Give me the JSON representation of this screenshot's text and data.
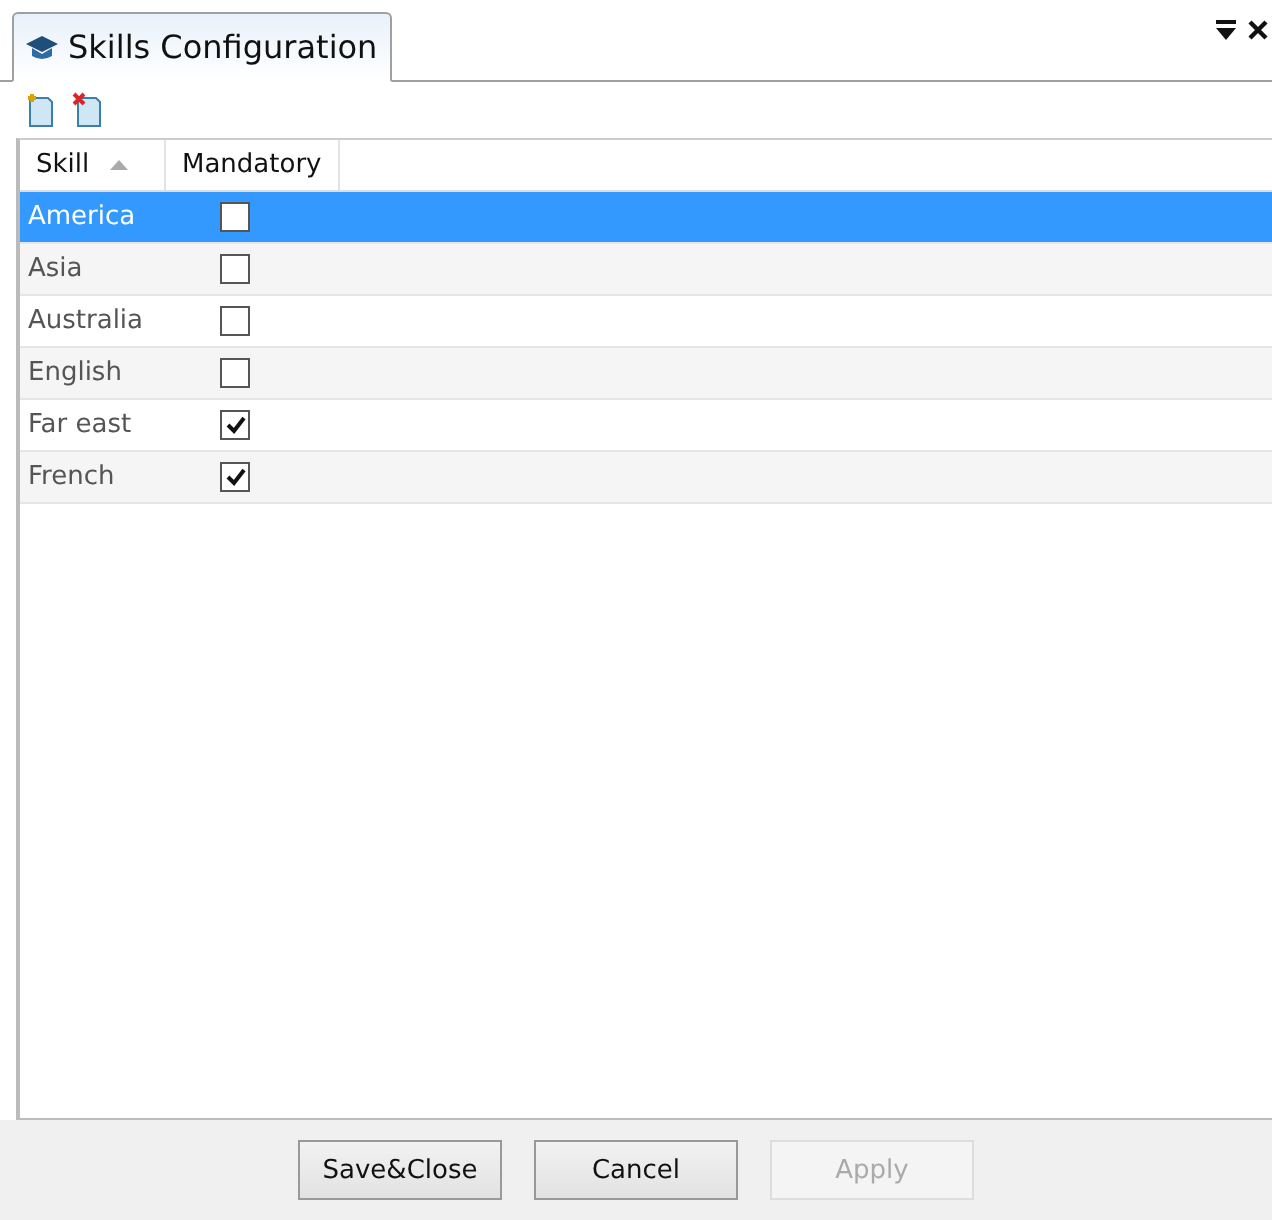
{
  "tab": {
    "title": "Skills Configuration",
    "selected": true
  },
  "table": {
    "columns": [
      {
        "label": "Skill",
        "sorted": true
      },
      {
        "label": "Mandatory",
        "sorted": false
      }
    ],
    "rows": [
      {
        "skill": "America",
        "mandatory": false,
        "selected": true
      },
      {
        "skill": "Asia",
        "mandatory": false,
        "selected": false
      },
      {
        "skill": "Australia",
        "mandatory": false,
        "selected": false
      },
      {
        "skill": "English",
        "mandatory": false,
        "selected": false
      },
      {
        "skill": "Far east",
        "mandatory": true,
        "selected": false
      },
      {
        "skill": "French",
        "mandatory": true,
        "selected": false
      }
    ]
  },
  "buttons": [
    {
      "label": "Save&Close",
      "disabled": false
    },
    {
      "label": "Cancel",
      "disabled": false
    },
    {
      "label": "Apply",
      "disabled": true
    }
  ]
}
